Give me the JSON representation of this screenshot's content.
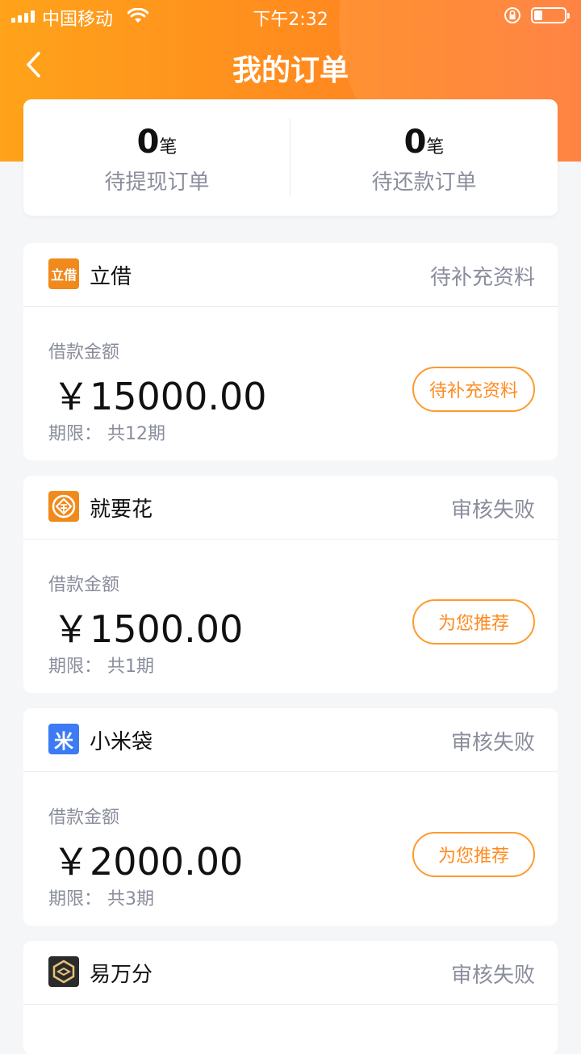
{
  "status_bar": {
    "carrier": "中国移动",
    "time": "下午2:32"
  },
  "nav": {
    "title": "我的订单"
  },
  "summary": {
    "withdraw": {
      "count": "0",
      "unit": "笔",
      "label": "待提现订单"
    },
    "repay": {
      "count": "0",
      "unit": "笔",
      "label": "待还款订单"
    }
  },
  "orders": [
    {
      "name": "立借",
      "logo_text": "立借",
      "logo_color": "#f08a1c",
      "status": "待补充资料",
      "amount_label": "借款金额",
      "amount": "￥15000.00",
      "term": "期限：  共12期",
      "button": "待补充资料"
    },
    {
      "name": "就要花",
      "logo_text": "",
      "logo_color": "#f08a1c",
      "status": "审核失败",
      "amount_label": "借款金额",
      "amount": "￥1500.00",
      "term": "期限：  共1期",
      "button": "为您推荐"
    },
    {
      "name": "小米袋",
      "logo_text": "米",
      "logo_color": "#3d7bf5",
      "status": "审核失败",
      "amount_label": "借款金额",
      "amount": "￥2000.00",
      "term": "期限：  共3期",
      "button": "为您推荐"
    },
    {
      "name": "易万分",
      "logo_text": "",
      "logo_color": "#2b2b2b",
      "status": "审核失败"
    }
  ],
  "colors": {
    "accent": "#ff8a1f",
    "header_gradient_start": "#ffa31a",
    "header_gradient_end": "#ff7a35",
    "muted_text": "#8a8d9c"
  }
}
